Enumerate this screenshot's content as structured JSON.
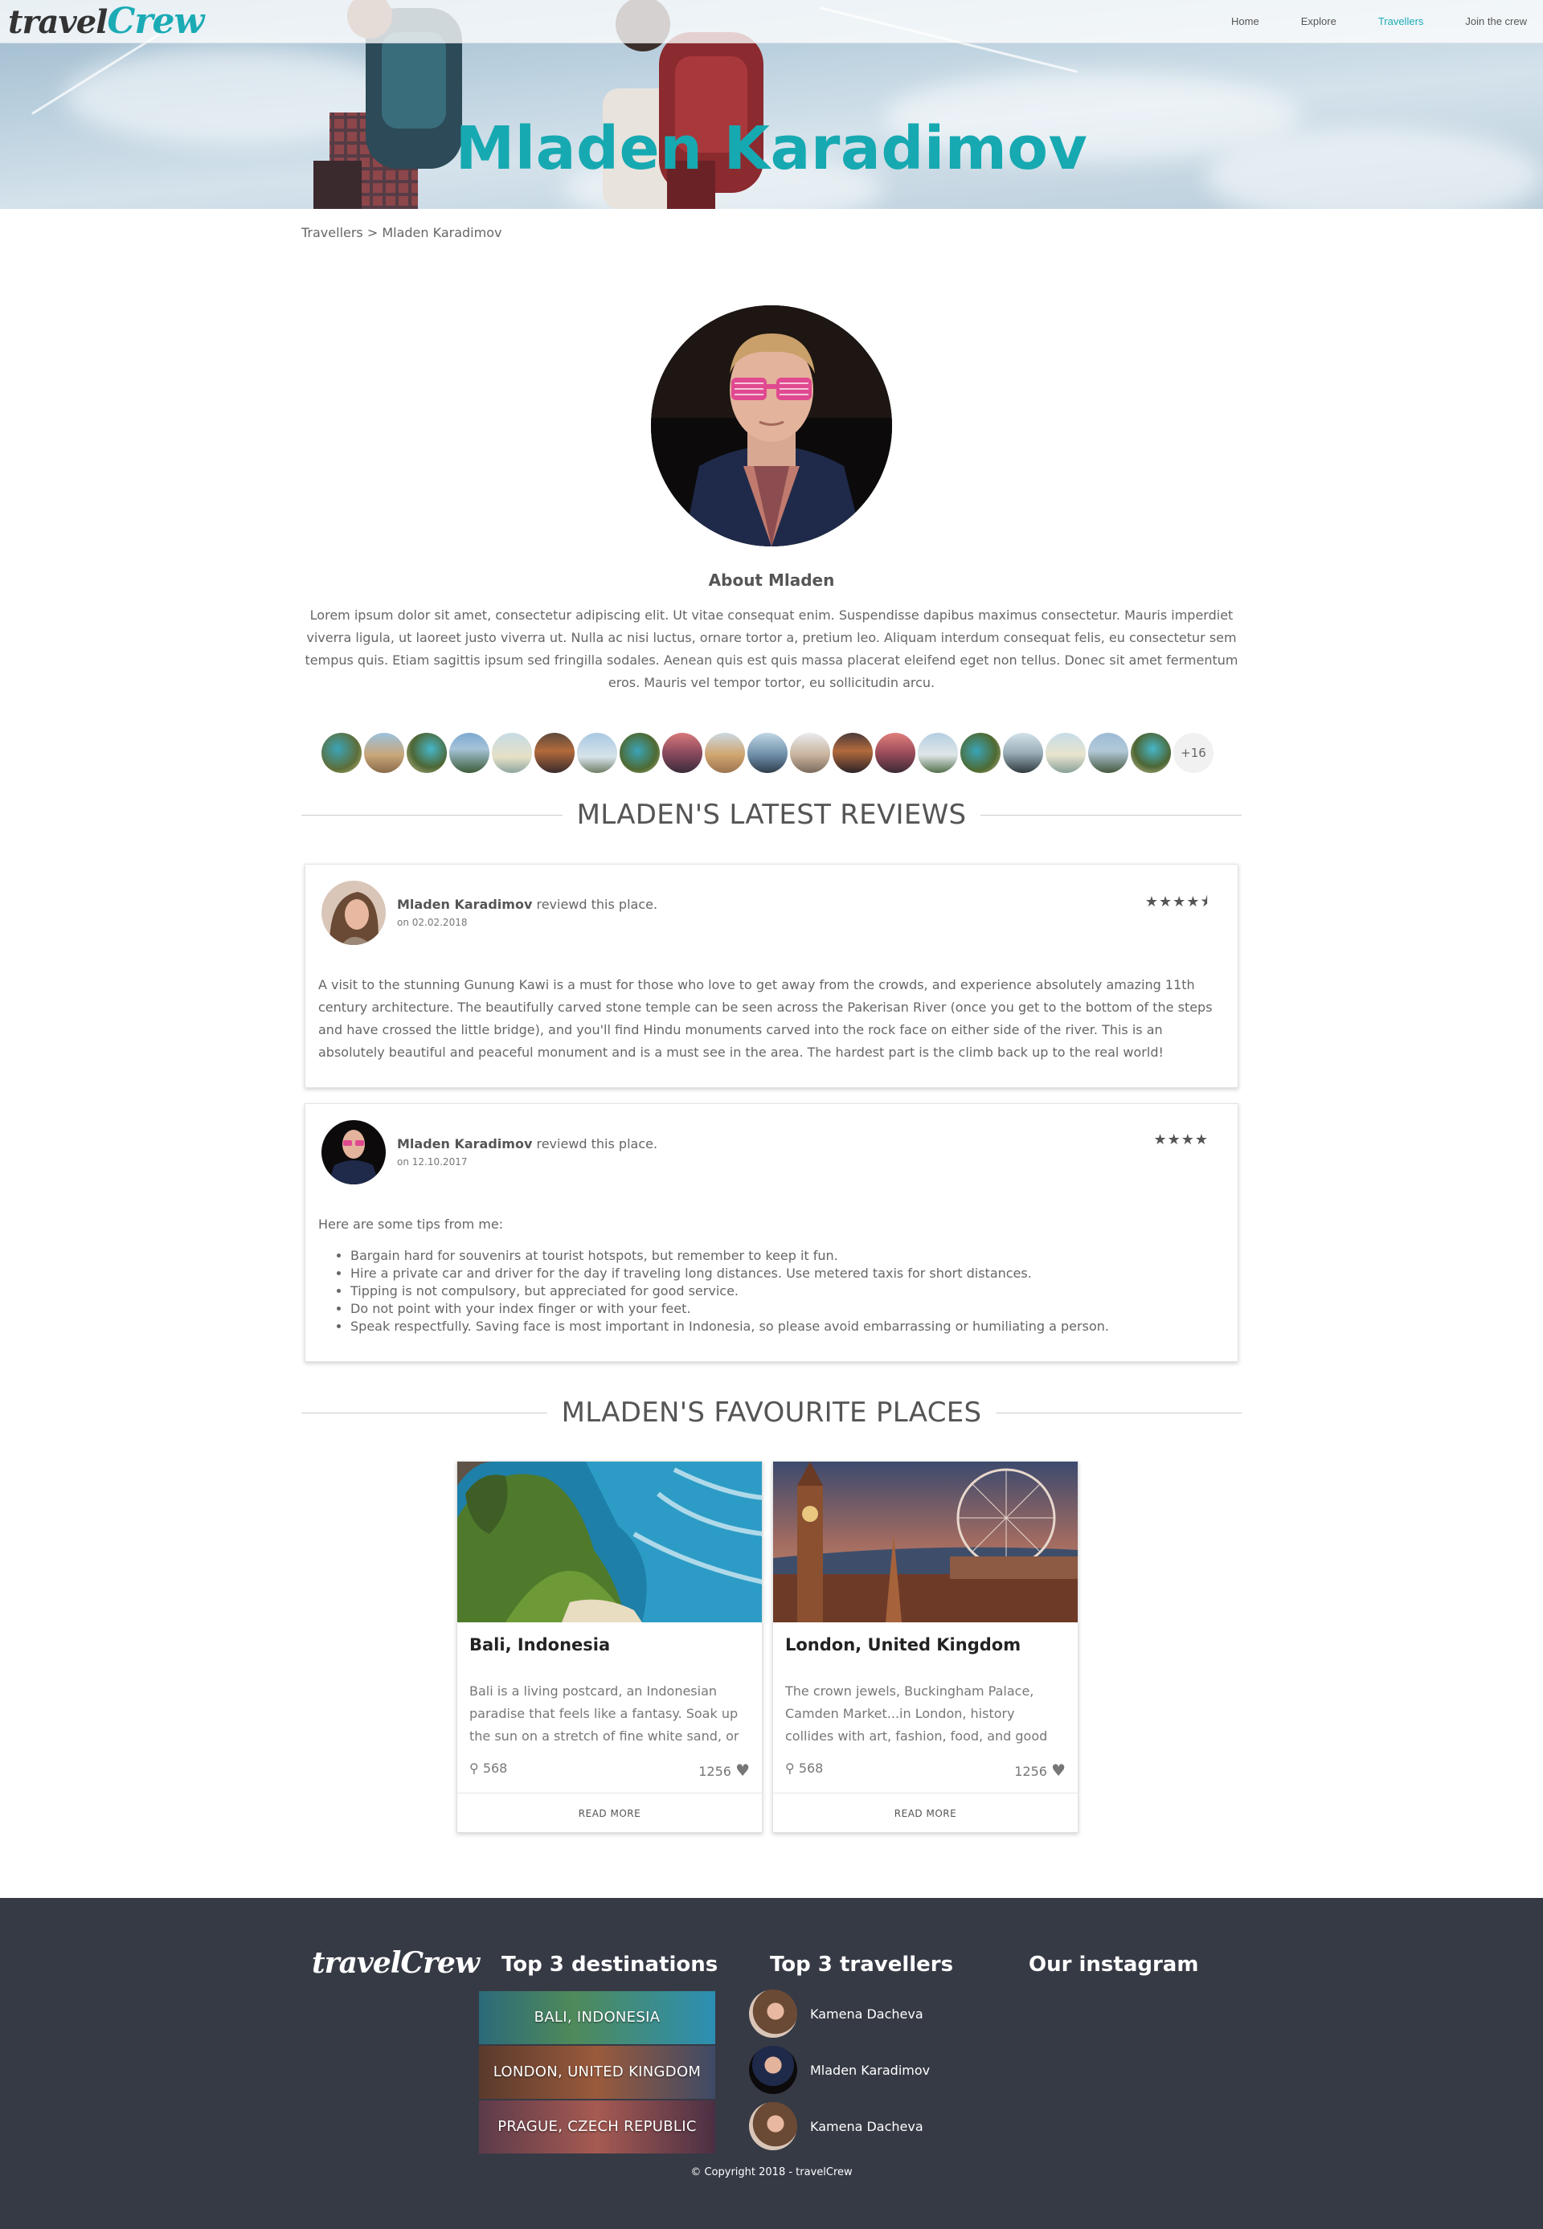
{
  "brand": {
    "logo_part1": "travel",
    "logo_part2": "Crew"
  },
  "nav": {
    "items": [
      "Home",
      "Explore",
      "Travellers",
      "Join the crew"
    ],
    "active": "Travellers"
  },
  "hero": {
    "title": "Mladen Karadimov"
  },
  "breadcrumb": "Travellers > Mladen Karadimov",
  "profile": {
    "about_title": "About Mladen",
    "about_text": "Lorem ipsum dolor sit amet, consectetur adipiscing elit. Ut vitae consequat enim. Suspendisse dapibus maximus consectetur. Mauris imperdiet viverra ligula, ut laoreet justo viverra ut. Nulla ac nisi luctus, ornare tortor a, pretium leo. Aliquam interdum consequat felis, eu consectetur sem tempus quis. Etiam sagittis ipsum sed fringilla sodales. Aenean quis est quis massa placerat eleifend eget non tellus. Donec sit amet fermentum eros. Mauris vel tempor tortor, eu sollicitudin arcu.",
    "visited_places_more": "+16"
  },
  "reviews_heading": "MLADEN'S LATEST REVIEWS",
  "reviews": [
    {
      "author": "Mladen Karadimov",
      "action": " reviewd this place.",
      "date": "on 02.02.2018",
      "stars": "★★★★⯨",
      "rating": 4.5,
      "text": "A visit to the stunning Gunung Kawi is a must for those who love to get away from the crowds, and experience absolutely amazing 11th century architecture. The beautifully carved stone temple can be seen across the Pakerisan River (once you get to the bottom of the steps and have crossed the little bridge), and you'll find Hindu monuments carved into the rock face on either side of the river. This is an absolutely beautiful and peaceful monument and is a must see in the area. The hardest part is the climb back up to the real world!"
    },
    {
      "author": "Mladen Karadimov",
      "action": " reviewd this place.",
      "date": "on 12.10.2017",
      "stars": "★★★★",
      "rating": 4,
      "intro": "Here are some tips from me:",
      "tips": [
        "Bargain hard for souvenirs at tourist hotspots, but remember to keep it fun.",
        "Hire a private car and driver for the day if traveling long distances. Use metered taxis for short distances.",
        "Tipping is not compulsory, but appreciated for good service.",
        "Do not point with your index finger or with your feet.",
        "Speak respectfully. Saving face is most important in Indonesia, so please avoid embarrassing or humiliating a person."
      ]
    }
  ],
  "favourites_heading": "MLADEN'S FAVOURITE PLACES",
  "favourites": [
    {
      "title": "Bali, Indonesia",
      "desc": "Bali is a living postcard, an Indonesian paradise that feels like a fantasy. Soak up the sun on a stretch of fine white sand, or",
      "pins": "568",
      "likes": "1256",
      "cta": "READ MORE"
    },
    {
      "title": "London, United Kingdom",
      "desc": "The crown jewels, Buckingham Palace, Camden Market...in London, history collides with art, fashion, food, and good British ale.",
      "pins": "568",
      "likes": "1256",
      "cta": "READ MORE"
    }
  ],
  "footer": {
    "logo_part1": "travel",
    "logo_part2": "Crew",
    "destinations_title": "Top 3 destinations",
    "destinations": [
      "BALI, INDONESIA",
      "LONDON, UNITED KINGDOM",
      "PRAGUE, CZECH REPUBLIC"
    ],
    "travellers_title": "Top 3 travellers",
    "travellers": [
      "Kamena Dacheva",
      "Mladen Karadimov",
      "Kamena Dacheva"
    ],
    "instagram_title": "Our instagram",
    "copyright": "© Copyright 2018 - travelCrew"
  },
  "colors": {
    "accent": "#1aabb5",
    "footer_bg": "#363a45",
    "text": "#555555"
  }
}
